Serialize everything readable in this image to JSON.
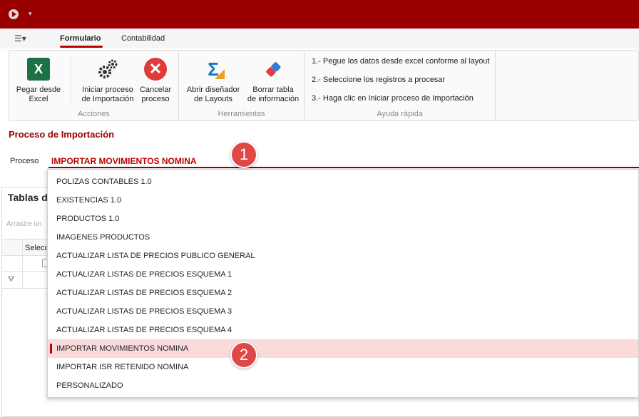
{
  "titlebar": {
    "qa_glyph": "▾"
  },
  "menu": {
    "icon_glyph": "☰▾"
  },
  "tabs": [
    {
      "label": "Formulario",
      "active": true
    },
    {
      "label": "Contabilidad",
      "active": false
    }
  ],
  "ribbon": {
    "acciones": {
      "label": "Acciones",
      "pegar": "Pegar desde\nExcel",
      "iniciar": "Iniciar proceso\nde Importación",
      "cancelar": "Cancelar\nproceso"
    },
    "herramientas": {
      "label": "Herramientas",
      "abrir": "Abrir diseñador\nde Layouts",
      "borrar": "Borrar tabla\nde información"
    },
    "ayuda": {
      "label": "Ayuda rápida",
      "lines": [
        "1.- Pegue los datos desde excel conforme al layout",
        "2.- Seleccione los registros a procesar",
        "3.- Haga clic en Iniciar proceso de Importación"
      ]
    },
    "icons": {
      "excel": "X",
      "cancel": "✕",
      "sigma": "Σ"
    }
  },
  "proceso": {
    "section_title": "Proceso de Importación",
    "label": "Proceso",
    "value": "IMPORTAR MOVIMIENTOS NOMINA",
    "options": [
      "POLIZAS CONTABLES 1.0",
      "EXISTENCIAS 1.0",
      "PRODUCTOS 1.0",
      "IMAGENES PRODUCTOS",
      "ACTUALIZAR LISTA DE PRECIOS PUBLICO GENERAL",
      "ACTUALIZAR LISTAS DE PRECIOS ESQUEMA 1",
      "ACTUALIZAR LISTAS DE PRECIOS ESQUEMA 2",
      "ACTUALIZAR LISTAS DE PRECIOS ESQUEMA 3",
      "ACTUALIZAR LISTAS DE PRECIOS ESQUEMA 4",
      "IMPORTAR MOVIMIENTOS NOMINA",
      "IMPORTAR ISR RETENIDO NOMINA",
      "PERSONALIZADO"
    ],
    "selected_index": 9
  },
  "tablas": {
    "title": "Tablas d",
    "drag_hint": "Arrastre un",
    "column_header": "Seleccio",
    "filter_glyph": "⛛"
  },
  "badges": {
    "one": "1",
    "two": "2"
  },
  "colors": {
    "brand": "#990000",
    "accent": "#c00000",
    "selected_row": "#fadada",
    "badge": "#e04848"
  }
}
